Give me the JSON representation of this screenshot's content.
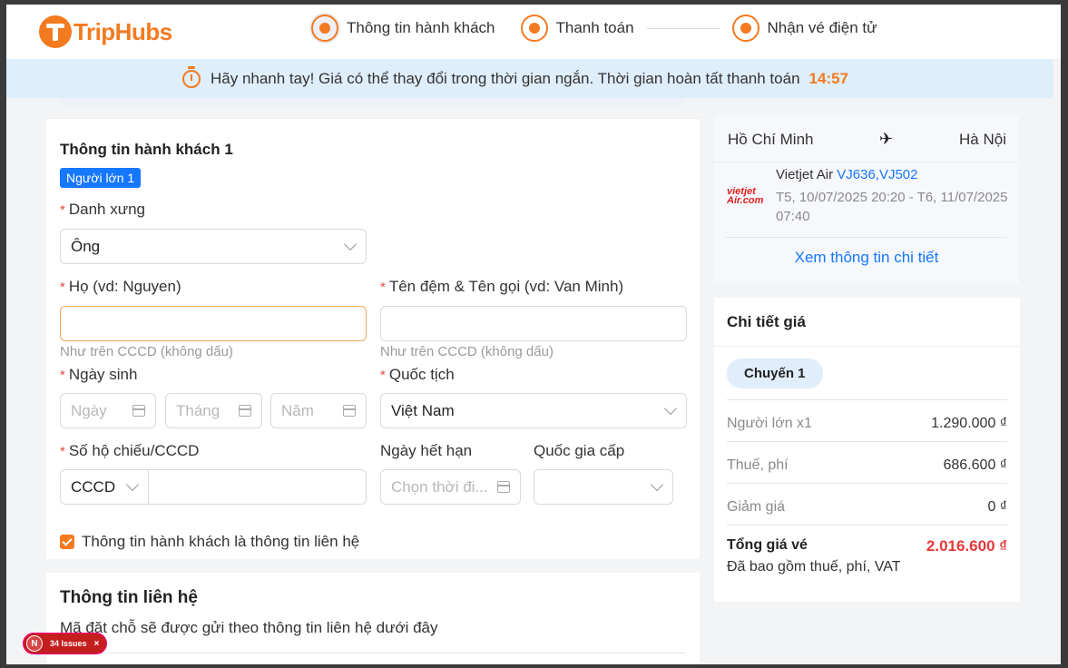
{
  "header": {
    "logo_text": "TripHubs",
    "steps": [
      {
        "label": "Thông tin hành khách"
      },
      {
        "label": "Thanh toán"
      },
      {
        "label": "Nhận vé điện tử"
      }
    ]
  },
  "timer": {
    "message": "Hãy nhanh tay! Giá có thể thay đổi trong thời gian ngắn. Thời gian hoàn tất thanh toán",
    "remaining": "14:57"
  },
  "passenger": {
    "title": "Thông tin hành khách 1",
    "badge": "Người lớn 1",
    "salutation_label": "Danh xưng",
    "salutation_value": "Ông",
    "last_name_label": "Họ (vd: Nguyen)",
    "last_name_hint": "Như trên CCCD (không dấu)",
    "first_name_label": "Tên đệm & Tên gọi (vd: Van Minh)",
    "first_name_hint": "Như trên CCCD (không dấu)",
    "dob_label": "Ngày sinh",
    "dob_day_placeholder": "Ngày",
    "dob_month_placeholder": "Tháng",
    "dob_year_placeholder": "Năm",
    "nationality_label": "Quốc tịch",
    "nationality_value": "Việt Nam",
    "doc_label": "Số hộ chiếu/CCCD",
    "doc_type_value": "CCCD",
    "expiry_label": "Ngày hết hạn",
    "expiry_placeholder": "Chọn thời đi...",
    "issuing_country_label": "Quốc gia cấp",
    "contact_checkbox_label": "Thông tin hành khách là thông tin liên hệ",
    "contact_checkbox_checked": true
  },
  "contact": {
    "title": "Thông tin liên hệ",
    "description": "Mã đặt chỗ sẽ được gửi theo thông tin liên hệ dưới đây"
  },
  "flight": {
    "origin": "Hồ Chí Minh",
    "destination": "Hà Nội",
    "airline_logo": "vietjet Air.com",
    "airline": "Vietjet Air",
    "flight_codes": "VJ636,VJ502",
    "schedule": "T5, 10/07/2025 20:20 - T6, 11/07/2025 07:40",
    "details_link": "Xem thông tin chi tiết"
  },
  "price": {
    "title": "Chi tiết giá",
    "chip": "Chuyến 1",
    "rows": [
      {
        "label": "Người lớn x1",
        "value": "1.290.000 ₫"
      },
      {
        "label": "Thuế, phí",
        "value": "686.600 ₫"
      },
      {
        "label": "Giảm giá",
        "value": "0 ₫"
      }
    ],
    "total_label": "Tổng giá vé",
    "total_value": "2.016.600 ₫",
    "total_note": "Đã bao gồm thuế, phí, VAT"
  },
  "devtools": {
    "issues_label": "34 Issues",
    "avatar_letter": "N",
    "close": "×"
  },
  "colors": {
    "accent": "#f47a20",
    "link": "#1677ff",
    "total": "#e5383b",
    "timer_bar": "#dfeefb"
  }
}
